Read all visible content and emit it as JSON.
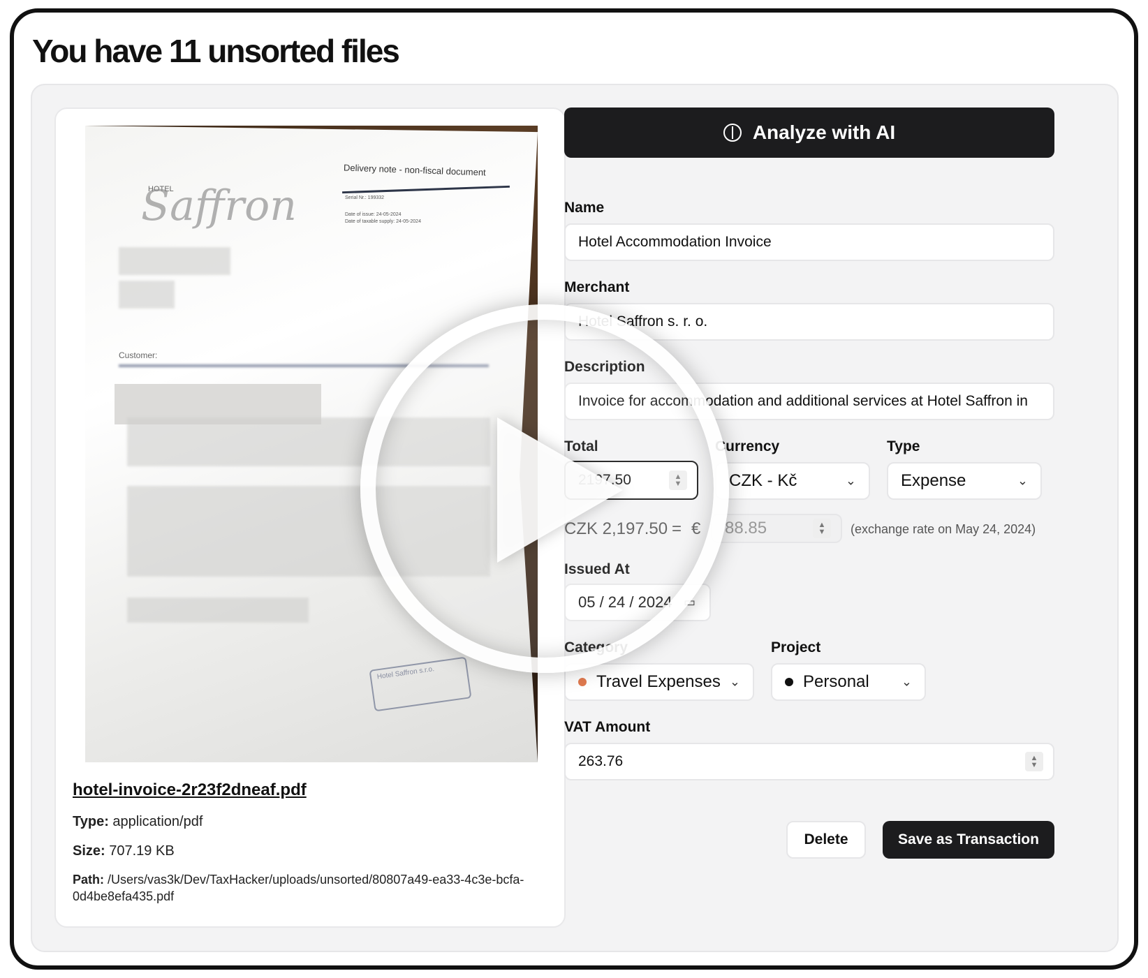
{
  "page": {
    "title": "You have 11 unsorted files"
  },
  "preview": {
    "document": {
      "heading": "Delivery note - non-fiscal document",
      "serial": "Serial Nr.: 199332",
      "date_issue": "Date of issue: 24-05-2024",
      "date_supply": "Date of taxable supply: 24-05-2024",
      "logo_top": "HOTEL",
      "logo_script": "Saffron",
      "customer_label": "Customer:",
      "stamp_text": "Hotel Saffron s.r.o."
    },
    "file_name": "hotel-invoice-2r23f2dneaf.pdf",
    "type_label": "Type:",
    "type_value": "application/pdf",
    "size_label": "Size:",
    "size_value": "707.19 KB",
    "path_label": "Path:",
    "path_value": "/Users/vas3k/Dev/TaxHacker/uploads/unsorted/80807a49-ea33-4c3e-bcfa-0d4be8efa435.pdf"
  },
  "form": {
    "analyze_label": "Analyze with AI",
    "name": {
      "label": "Name",
      "value": "Hotel Accommodation Invoice"
    },
    "merchant": {
      "label": "Merchant",
      "value": "Hotel Saffron s. r. o."
    },
    "description": {
      "label": "Description",
      "value": "Invoice for accommodation and additional services at Hotel Saffron in"
    },
    "total": {
      "label": "Total",
      "value": "2197.50"
    },
    "currency": {
      "label": "Currency",
      "value": "CZK - Kč"
    },
    "type": {
      "label": "Type",
      "value": "Expense"
    },
    "conversion": {
      "source": "CZK 2,197.50",
      "equals": "=",
      "target_symbol": "€",
      "target_value": "88.85",
      "note": "(exchange rate on May 24, 2024)"
    },
    "issued_at": {
      "label": "Issued At",
      "value": "05 / 24 / 2024"
    },
    "category": {
      "label": "Category",
      "value": "Travel Expenses",
      "dot_color": "#e07a4f"
    },
    "project": {
      "label": "Project",
      "value": "Personal",
      "dot_color": "#111111"
    },
    "vat_amount": {
      "label": "VAT Amount",
      "value": "263.76"
    },
    "delete_label": "Delete",
    "save_label": "Save as Transaction"
  },
  "overlay": {
    "icon": "play-icon"
  }
}
